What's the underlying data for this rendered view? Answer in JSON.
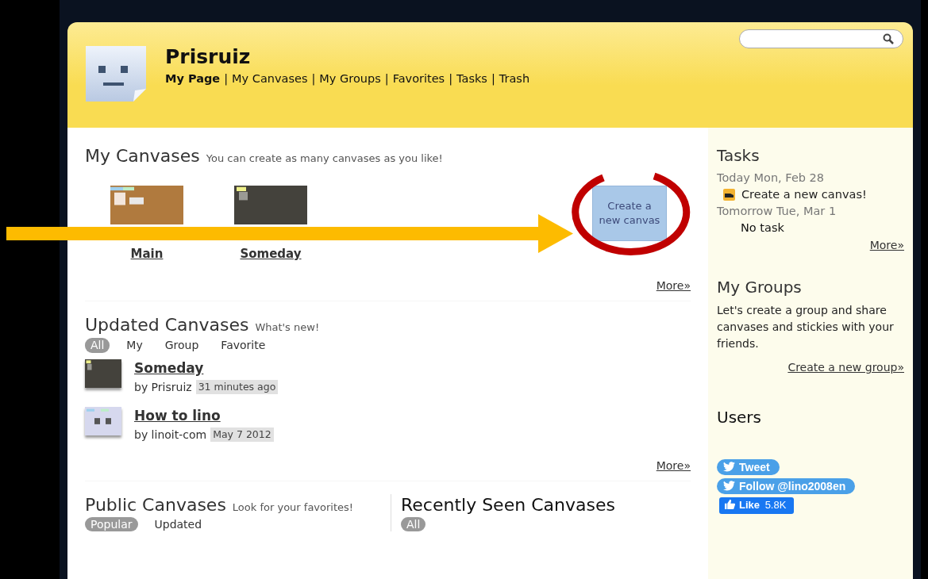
{
  "header": {
    "title": "Prisruiz",
    "separator": "|",
    "nav": [
      {
        "label": "My Page",
        "selected": true
      },
      {
        "label": "My Canvases",
        "selected": false
      },
      {
        "label": "My Groups",
        "selected": false
      },
      {
        "label": "Favorites",
        "selected": false
      },
      {
        "label": "Tasks",
        "selected": false
      },
      {
        "label": "Trash",
        "selected": false
      }
    ]
  },
  "my_canvases": {
    "title": "My Canvases",
    "subtitle": "You can create as many canvases as you like!",
    "canvases": [
      {
        "name": "Main",
        "kind": "cork"
      },
      {
        "name": "Someday",
        "kind": "dark"
      }
    ],
    "create_button": "Create a new canvas",
    "more": "More»"
  },
  "updated_canvases": {
    "title": "Updated Canvases",
    "subtitle": "What's new!",
    "filters": [
      {
        "label": "All",
        "selected": true
      },
      {
        "label": "My",
        "selected": false
      },
      {
        "label": "Group",
        "selected": false
      },
      {
        "label": "Favorite",
        "selected": false
      }
    ],
    "items": [
      {
        "title": "Someday",
        "by": "by Prisruiz",
        "time": "31 minutes ago",
        "kind": "dark"
      },
      {
        "title": "How to lino",
        "by": "by linoit-com",
        "time": "May 7 2012",
        "kind": "light"
      }
    ],
    "more": "More»"
  },
  "public_canvases": {
    "title": "Public Canvases",
    "subtitle": "Look for your favorites!",
    "filters": [
      {
        "label": "Popular",
        "selected": true
      },
      {
        "label": "Updated",
        "selected": false
      }
    ]
  },
  "recently_seen": {
    "title": "Recently Seen Canvases",
    "filters": [
      {
        "label": "All",
        "selected": true
      }
    ]
  },
  "sidebar": {
    "tasks": {
      "title": "Tasks",
      "days": [
        {
          "date": "Today Mon, Feb 28",
          "tasks": [
            "Create a new canvas!"
          ]
        },
        {
          "date": "Tomorrow Tue, Mar 1",
          "empty": "No task"
        }
      ],
      "more": "More»"
    },
    "groups": {
      "title": "My Groups",
      "text": "Let's create a group and share canvases and stickies with your friends.",
      "link": "Create a new group»"
    },
    "users": {
      "title": "Users"
    },
    "social": {
      "tweet": "Tweet",
      "follow": "Follow @lino2008en",
      "like": "Like",
      "like_count": "5.8K"
    }
  }
}
